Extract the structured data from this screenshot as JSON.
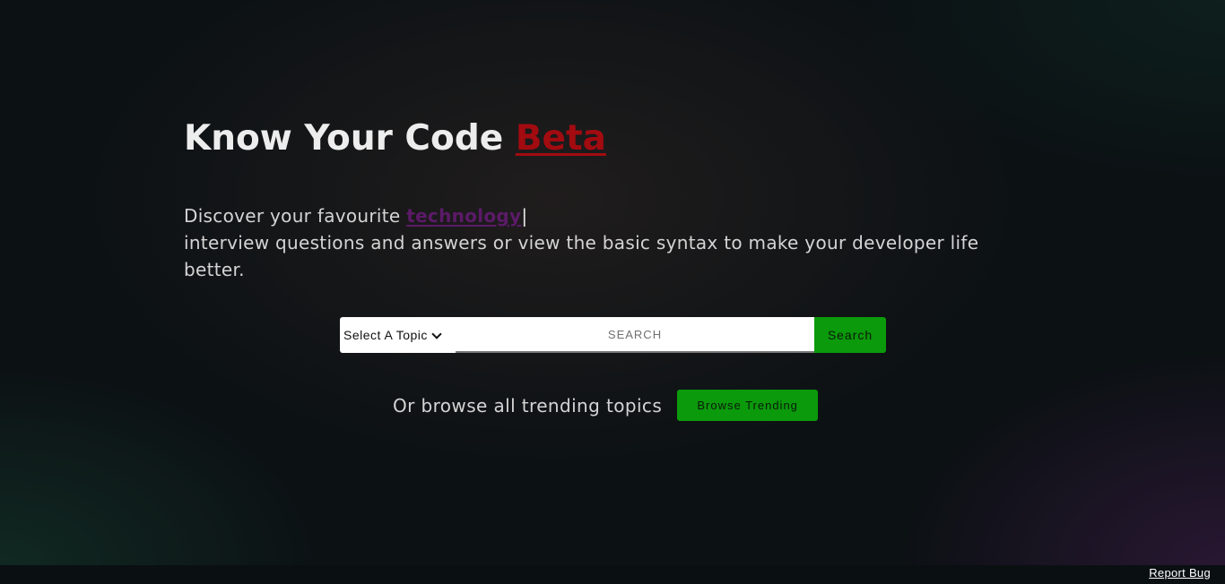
{
  "hero": {
    "title_main": "Know Your Code",
    "title_badge": "Beta",
    "desc_prefix": "Discover your favourite",
    "desc_highlight": "technology",
    "desc_cursor": "|",
    "desc_rest": "interview questions and answers or view the basic syntax to make your developer life better."
  },
  "search": {
    "topic_select_value": "Select A Topic",
    "input_placeholder": "SEARCH",
    "button_label": "Search"
  },
  "browse": {
    "text": "Or browse all trending topics",
    "button_label": "Browse Trending"
  },
  "footer": {
    "report_bug_label": "Report Bug"
  },
  "colors": {
    "accent_green": "#0b9a0b",
    "beta_red": "#a20b10",
    "highlight_purple": "#5c1a68"
  }
}
